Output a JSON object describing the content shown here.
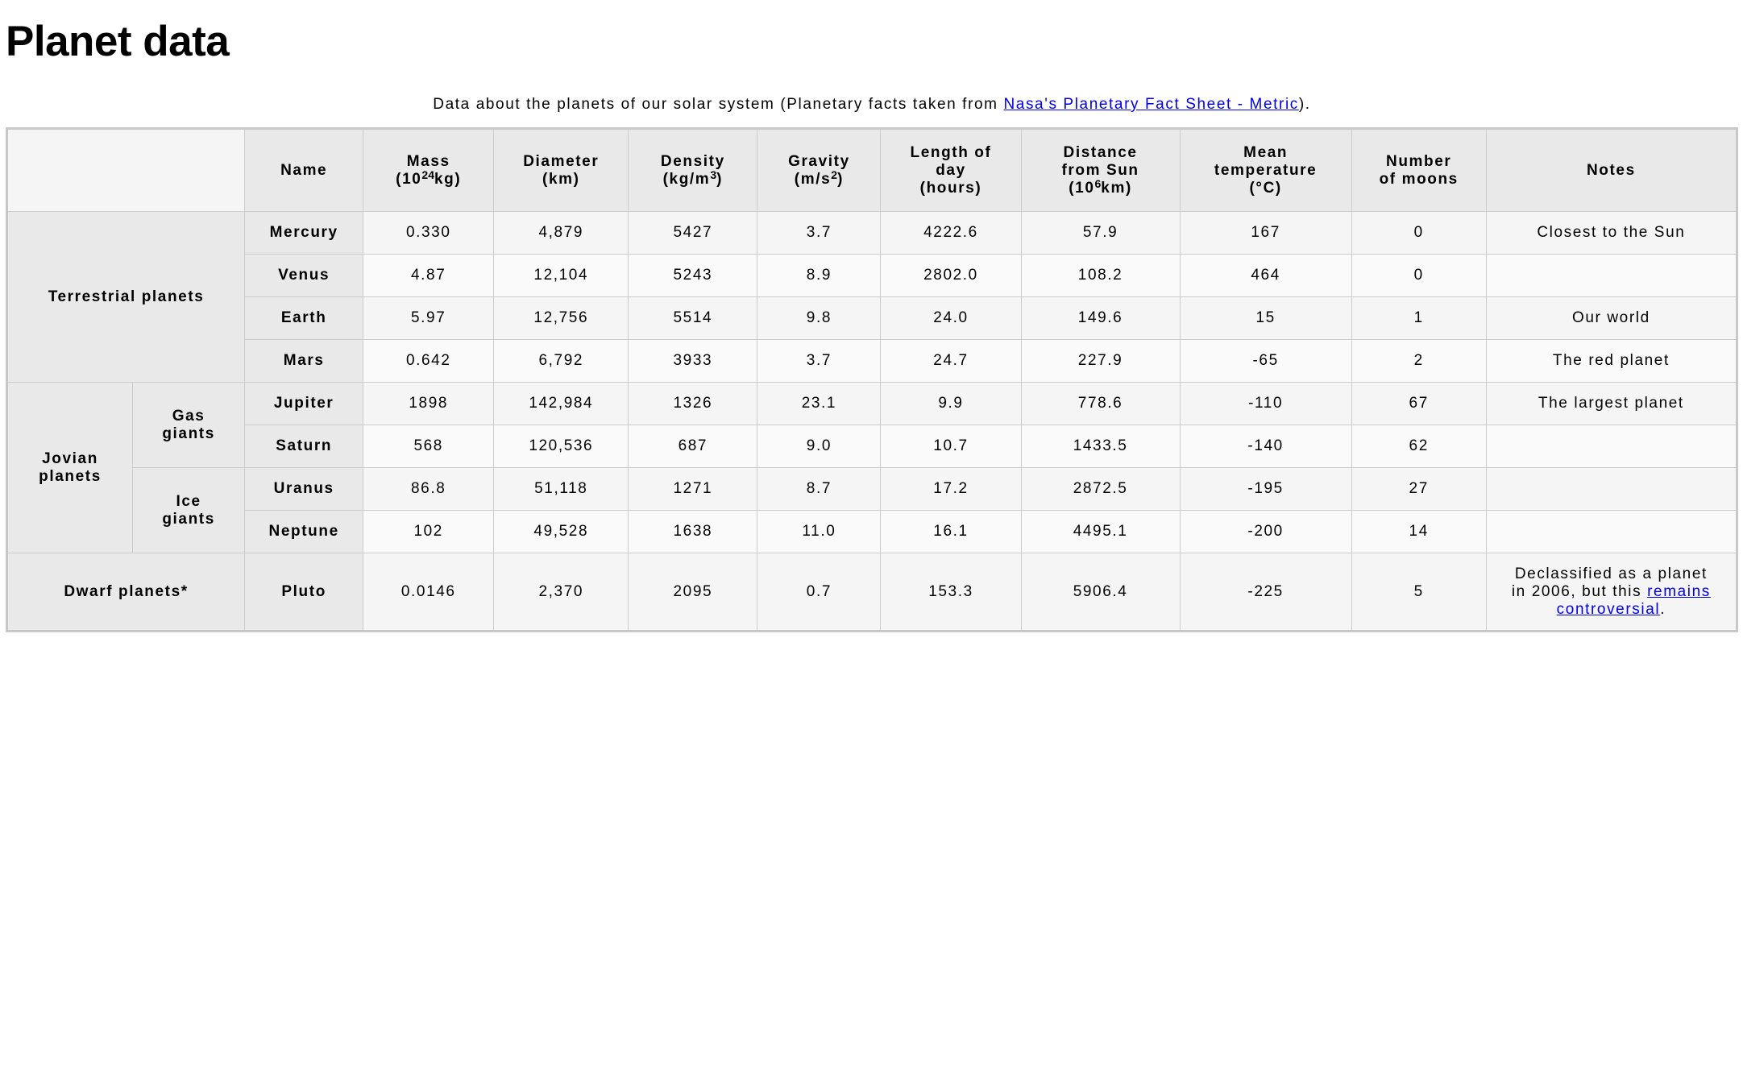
{
  "page": {
    "title": "Planet data",
    "caption_prefix": "Data about the planets of our solar system (Planetary facts taken from ",
    "caption_link": "Nasa's Planetary Fact Sheet - Metric",
    "caption_suffix": ")."
  },
  "table": {
    "headers": {
      "name": "Name",
      "mass_a": "Mass",
      "mass_b": "(10",
      "mass_sup": "24",
      "mass_c": "kg)",
      "diameter_a": "Diameter",
      "diameter_b": "(km)",
      "density_a": "Density",
      "density_b": "(kg/m",
      "density_sup": "3",
      "density_c": ")",
      "gravity_a": "Gravity",
      "gravity_b": "(m/s",
      "gravity_sup": "2",
      "gravity_c": ")",
      "day_a": "Length of",
      "day_b": "day",
      "day_c": "(hours)",
      "distance_a": "Distance",
      "distance_b": "from Sun",
      "distance_c": "(10",
      "distance_sup": "6",
      "distance_d": "km)",
      "temp_a": "Mean",
      "temp_b": "temperature",
      "temp_c": "(°C)",
      "moons_a": "Number",
      "moons_b": "of moons",
      "notes": "Notes"
    },
    "groups": {
      "terrestrial": "Terrestrial planets",
      "jovian_a": "Jovian",
      "jovian_b": "planets",
      "gas_a": "Gas",
      "gas_b": "giants",
      "ice_a": "Ice",
      "ice_b": "giants",
      "dwarf": "Dwarf planets*"
    },
    "rows": [
      {
        "name": "Mercury",
        "mass": "0.330",
        "diameter": "4,879",
        "density": "5427",
        "gravity": "3.7",
        "day": "4222.6",
        "distance": "57.9",
        "temp": "167",
        "moons": "0",
        "notes": "Closest to the Sun"
      },
      {
        "name": "Venus",
        "mass": "4.87",
        "diameter": "12,104",
        "density": "5243",
        "gravity": "8.9",
        "day": "2802.0",
        "distance": "108.2",
        "temp": "464",
        "moons": "0",
        "notes": ""
      },
      {
        "name": "Earth",
        "mass": "5.97",
        "diameter": "12,756",
        "density": "5514",
        "gravity": "9.8",
        "day": "24.0",
        "distance": "149.6",
        "temp": "15",
        "moons": "1",
        "notes": "Our world"
      },
      {
        "name": "Mars",
        "mass": "0.642",
        "diameter": "6,792",
        "density": "3933",
        "gravity": "3.7",
        "day": "24.7",
        "distance": "227.9",
        "temp": "-65",
        "moons": "2",
        "notes": "The red planet"
      },
      {
        "name": "Jupiter",
        "mass": "1898",
        "diameter": "142,984",
        "density": "1326",
        "gravity": "23.1",
        "day": "9.9",
        "distance": "778.6",
        "temp": "-110",
        "moons": "67",
        "notes": "The largest planet"
      },
      {
        "name": "Saturn",
        "mass": "568",
        "diameter": "120,536",
        "density": "687",
        "gravity": "9.0",
        "day": "10.7",
        "distance": "1433.5",
        "temp": "-140",
        "moons": "62",
        "notes": ""
      },
      {
        "name": "Uranus",
        "mass": "86.8",
        "diameter": "51,118",
        "density": "1271",
        "gravity": "8.7",
        "day": "17.2",
        "distance": "2872.5",
        "temp": "-195",
        "moons": "27",
        "notes": ""
      },
      {
        "name": "Neptune",
        "mass": "102",
        "diameter": "49,528",
        "density": "1638",
        "gravity": "11.0",
        "day": "16.1",
        "distance": "4495.1",
        "temp": "-200",
        "moons": "14",
        "notes": ""
      },
      {
        "name": "Pluto",
        "mass": "0.0146",
        "diameter": "2,370",
        "density": "2095",
        "gravity": "0.7",
        "day": "153.3",
        "distance": "5906.4",
        "temp": "-225",
        "moons": "5",
        "notes": ""
      }
    ],
    "pluto_note": {
      "line1": "Declassified as a planet",
      "line2": "in 2006, but this ",
      "link": "remains controversial",
      "suffix": "."
    }
  }
}
